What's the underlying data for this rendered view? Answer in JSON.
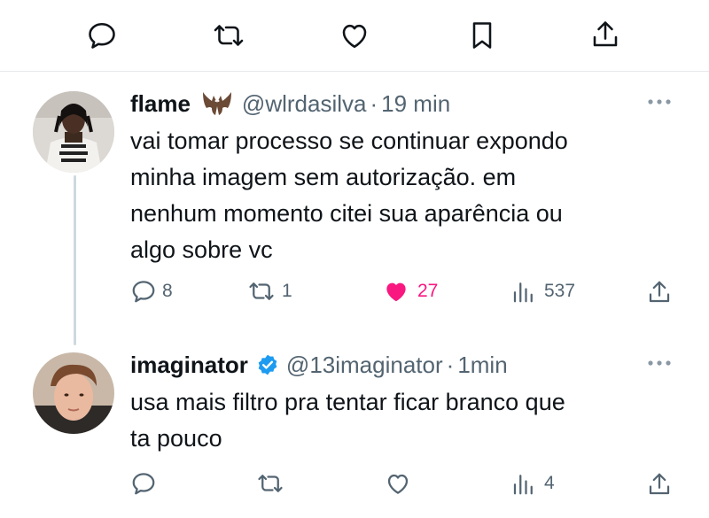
{
  "top_actions": {
    "icons": [
      "reply-icon",
      "retweet-icon",
      "like-icon",
      "bookmark-icon",
      "share-icon"
    ]
  },
  "tweets": [
    {
      "name": "flame",
      "name_emoji": "bat-emoji",
      "handle": "@wlrdasilva",
      "separator": "·",
      "time": "19 min",
      "lines": [
        "vai tomar processo se continuar expondo",
        "minha imagem sem autorização. em",
        "nenhum momento citei sua aparência ou",
        "algo sobre vc"
      ],
      "actions": {
        "replies": "8",
        "retweets": "1",
        "likes": "27",
        "views": "537"
      },
      "liked": true,
      "colors": {
        "like_active": "#f91880"
      }
    },
    {
      "name": "imaginator",
      "verified": true,
      "handle": "@13imaginator",
      "separator": "·",
      "time": "1min",
      "lines": [
        "usa mais filtro pra tentar ficar branco que",
        "ta pouco"
      ],
      "actions": {
        "replies": "",
        "retweets": "",
        "likes": "",
        "views": "4"
      },
      "liked": false,
      "colors": {
        "verified_badge": "#1d9bf0"
      }
    }
  ],
  "colors": {
    "text": "#0f1419",
    "muted": "#536471",
    "divider": "#e6e9ec",
    "thread_line": "#cfd9de"
  }
}
